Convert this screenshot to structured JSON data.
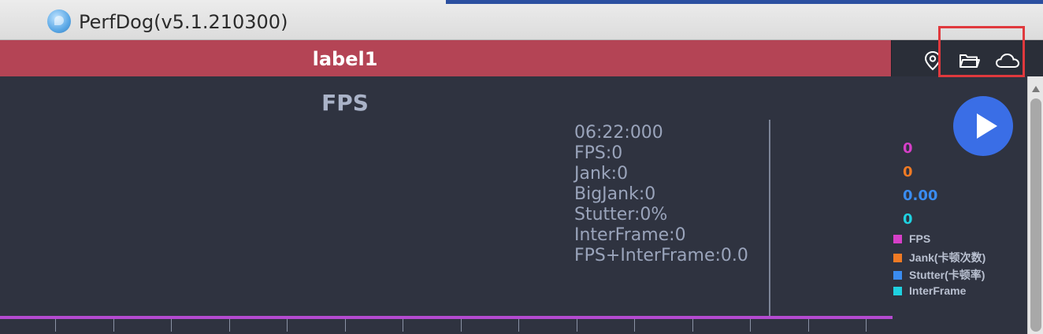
{
  "window": {
    "title": "PerfDog(v5.1.210300)",
    "app_icon": "perfdog-logo-icon"
  },
  "label_bar": {
    "label": "label1",
    "color": "#b44455"
  },
  "toolbar": {
    "icons": [
      "location-pin-icon",
      "folder-icon",
      "cloud-icon"
    ],
    "highlight_color": "#e0393d"
  },
  "chart": {
    "title": "FPS",
    "tooltip": {
      "time": "06:22:000",
      "fps": "FPS:0",
      "jank": "Jank:0",
      "bigjank": "BigJank:0",
      "stutter": "Stutter:0%",
      "interframe": "InterFrame:0",
      "fps_interframe": "FPS+InterFrame:0.0"
    },
    "current_values": [
      {
        "value": "0",
        "color": "#d63fc8"
      },
      {
        "value": "0",
        "color": "#f07a24"
      },
      {
        "value": "0.00",
        "color": "#3a8cf0"
      },
      {
        "value": "0",
        "color": "#1fd1e0"
      }
    ],
    "legend": [
      {
        "label": "FPS",
        "color": "#d63fc8"
      },
      {
        "label": "Jank(卡顿次数)",
        "color": "#f07a24"
      },
      {
        "label": "Stutter(卡顿率)",
        "color": "#3a8cf0"
      },
      {
        "label": "InterFrame",
        "color": "#1fd1e0"
      }
    ]
  },
  "controls": {
    "play_icon": "play-icon"
  }
}
